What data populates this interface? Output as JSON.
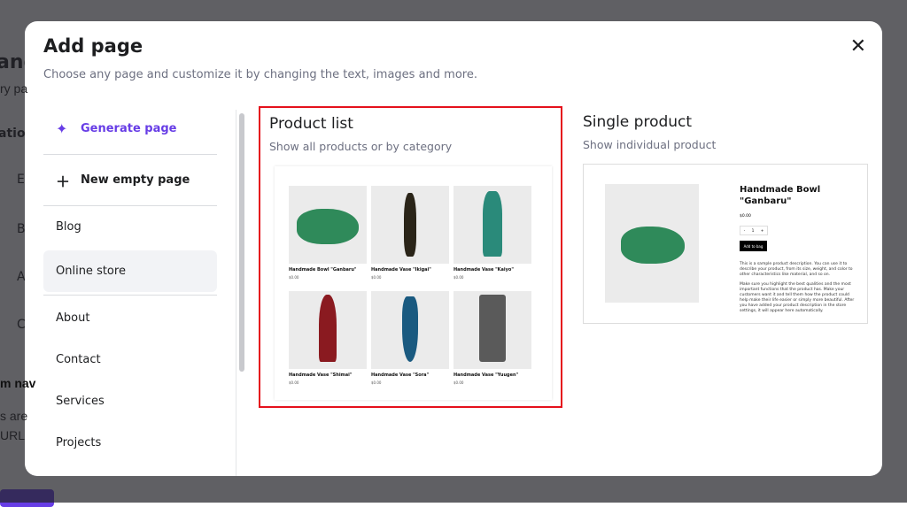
{
  "background": {
    "fragments": [
      "and",
      "ry pa",
      "ation",
      "E",
      "B",
      "A",
      "C",
      "m nav",
      "s are",
      "URL"
    ]
  },
  "modal": {
    "title": "Add page",
    "subtitle": "Choose any page and customize it by changing the text, images and more.",
    "nav": [
      {
        "label": "Generate page",
        "icon": "sparkle-icon"
      },
      {
        "label": "New empty page",
        "icon": "plus-icon"
      },
      {
        "label": "Blog"
      },
      {
        "label": "Online store"
      },
      {
        "label": "About"
      },
      {
        "label": "Contact"
      },
      {
        "label": "Services"
      },
      {
        "label": "Projects"
      }
    ],
    "cards": [
      {
        "title": "Product list",
        "subtitle": "Show all products or by category",
        "products": [
          {
            "name": "Handmade Bowl \"Ganbaru\"",
            "price": "$0.00",
            "color": "#2f8a5a"
          },
          {
            "name": "Handmade Vase \"Ikigai\"",
            "price": "$0.00",
            "color": "#2a2418"
          },
          {
            "name": "Handmade Vase \"Kaiyo\"",
            "price": "$0.00",
            "color": "#2a8a7a"
          },
          {
            "name": "Handmade Vase \"Shimai\"",
            "price": "$0.00",
            "color": "#8a1a20"
          },
          {
            "name": "Handmade Vase \"Sora\"",
            "price": "$0.00",
            "color": "#1a5a80"
          },
          {
            "name": "Handmade Vase \"Yuugen\"",
            "price": "$0.00",
            "color": "#5a5a5a"
          }
        ]
      },
      {
        "title": "Single product",
        "subtitle": "Show individual product",
        "product": {
          "name": "Handmade Bowl \"Ganbaru\"",
          "price": "$0.00",
          "qty": "1",
          "minus": "-",
          "plus": "+",
          "button": "Add to bag",
          "desc1": "This is a sample product description. You can use it to describe your product, from its size, weight, and color to other characteristics like material, and so on.",
          "desc2": "Make sure you highlight the best qualities and the most important functions that the product has. Make your customers want it and tell them how the product could help make their life easier or simply more beautiful. After you have added your product description in the store settings, it will appear here automatically."
        }
      }
    ]
  },
  "colors": {
    "accent": "#673de6",
    "selected_border": "#e5111c"
  }
}
